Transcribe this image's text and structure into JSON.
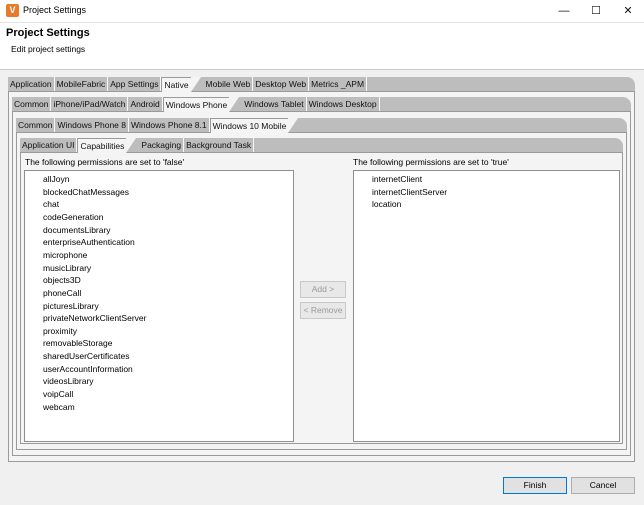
{
  "window": {
    "title": "Project Settings",
    "app_icon": "V",
    "minimize": "—",
    "maximize": "☐",
    "close": "✕"
  },
  "header": {
    "title": "Project Settings",
    "subtitle": "Edit project settings"
  },
  "tabs_l1": [
    {
      "label": "Application",
      "active": false
    },
    {
      "label": "MobileFabric",
      "active": false
    },
    {
      "label": "App Settings",
      "active": false
    },
    {
      "label": "Native",
      "active": true
    },
    {
      "label": "Mobile Web",
      "active": false
    },
    {
      "label": "Desktop Web",
      "active": false
    },
    {
      "label": "Metrics _APM",
      "active": false
    }
  ],
  "tabs_l2": [
    {
      "label": "Common",
      "active": false
    },
    {
      "label": "iPhone/iPad/Watch",
      "active": false
    },
    {
      "label": "Android",
      "active": false
    },
    {
      "label": "Windows Phone",
      "active": true
    },
    {
      "label": "Windows Tablet",
      "active": false
    },
    {
      "label": "Windows Desktop",
      "active": false
    }
  ],
  "tabs_l3": [
    {
      "label": "Common",
      "active": false
    },
    {
      "label": "Windows Phone 8",
      "active": false
    },
    {
      "label": "Windows Phone 8.1",
      "active": false
    },
    {
      "label": "Windows 10 Mobile",
      "active": true
    }
  ],
  "tabs_l4": [
    {
      "label": "Application UI",
      "active": false
    },
    {
      "label": "Capabilities",
      "active": true
    },
    {
      "label": "Packaging",
      "active": false
    },
    {
      "label": "Background Task",
      "active": false
    }
  ],
  "left_list": {
    "label": "The following permissions are set to 'false'",
    "items": [
      "allJoyn",
      "blockedChatMessages",
      "chat",
      "codeGeneration",
      "documentsLibrary",
      "enterpriseAuthentication",
      "microphone",
      "musicLibrary",
      "objects3D",
      "phoneCall",
      "picturesLibrary",
      "privateNetworkClientServer",
      "proximity",
      "removableStorage",
      "sharedUserCertificates",
      "userAccountInformation",
      "videosLibrary",
      "voipCall",
      "webcam"
    ]
  },
  "right_list": {
    "label": "The following permissions are set to 'true'",
    "items": [
      "internetClient",
      "internetClientServer",
      "location"
    ]
  },
  "buttons": {
    "add": "Add >",
    "remove": "< Remove",
    "finish": "Finish",
    "cancel": "Cancel"
  }
}
